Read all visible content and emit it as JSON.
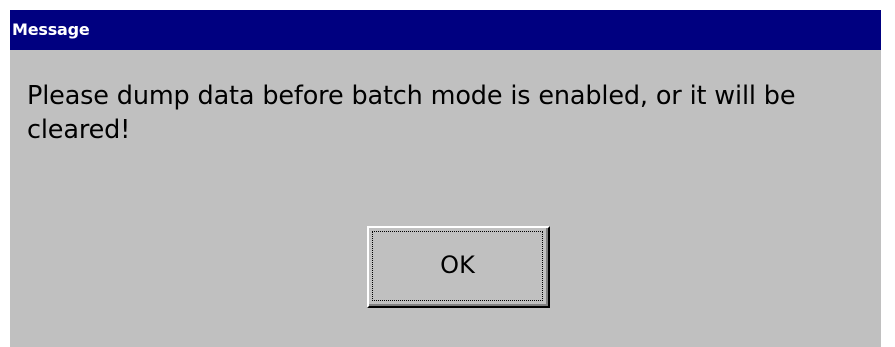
{
  "dialog": {
    "title": "Message",
    "message": "Please dump data before batch mode is enabled, or it will be cleared!",
    "ok_label": "OK"
  },
  "colors": {
    "titlebar": "#000080",
    "title_text": "#ffffff",
    "dialog_background": "#c0c0c0",
    "text": "#000000"
  }
}
